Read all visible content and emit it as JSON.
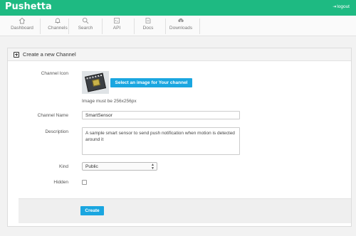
{
  "app": {
    "brand": "Pushetta",
    "logout_icon": "logout-arrow-icon",
    "logout_label": "logout",
    "accent": "#1eba82"
  },
  "nav": [
    {
      "label": "Dashboard",
      "icon": "home-icon"
    },
    {
      "label": "Channels",
      "icon": "bell-icon"
    },
    {
      "label": "Search",
      "icon": "search-icon"
    },
    {
      "label": "API",
      "icon": "code-icon"
    },
    {
      "label": "Docs",
      "icon": "docs-icon"
    },
    {
      "label": "Downloads",
      "icon": "cloud-download-icon"
    }
  ],
  "panel": {
    "title": "Create a new Channel"
  },
  "form": {
    "channel_icon_label": "Channel Icon",
    "select_image_button": "Select an image for Your channel",
    "image_hint": "Image must be 256x256px",
    "channel_name_label": "Channel Name",
    "channel_name_value": "SmartSensor",
    "description_label": "Description",
    "description_value": "A sample smart sensor to send push notification when motion is detected around it",
    "kind_label": "Kind",
    "kind_value": "Public",
    "hidden_label": "Hidden",
    "hidden_checked": false,
    "create_button": "Create",
    "button_color": "#1aa6e0"
  }
}
